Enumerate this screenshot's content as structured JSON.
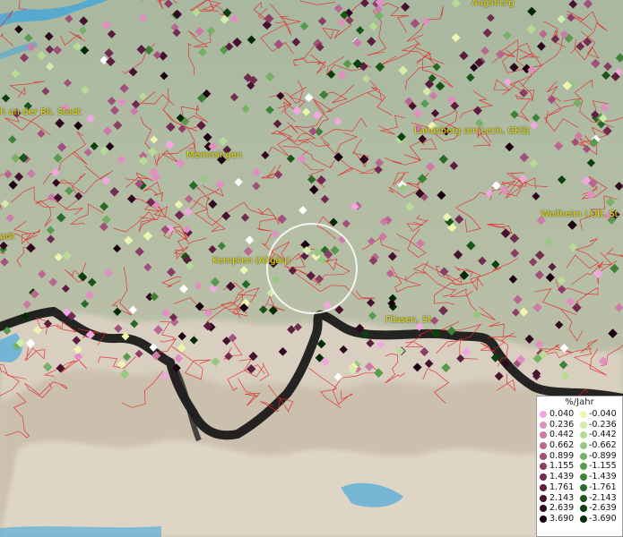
{
  "cities": [
    {
      "name": "Augsburg"
    },
    {
      "name": "h an der Ril, Stadt"
    },
    {
      "name": "Memmingen"
    },
    {
      "name": "Landsberg am Lech, GKSt"
    },
    {
      "name": "Weilheim i.OB, St"
    },
    {
      "name": "adt"
    },
    {
      "name": "Kempten (Allgäu)"
    },
    {
      "name": "Füssen, St"
    }
  ],
  "legend": {
    "title": "%/Jahr",
    "positive": [
      {
        "value": "0.040",
        "color": "#f0a8e0"
      },
      {
        "value": "0.236",
        "color": "#e090c0"
      },
      {
        "value": "0.442",
        "color": "#cc7aa6"
      },
      {
        "value": "0.662",
        "color": "#b86890"
      },
      {
        "value": "0.899",
        "color": "#a0507a"
      },
      {
        "value": "1.155",
        "color": "#8a3e66"
      },
      {
        "value": "1.439",
        "color": "#722c52"
      },
      {
        "value": "1.761",
        "color": "#5c1e40"
      },
      {
        "value": "2.143",
        "color": "#461230"
      },
      {
        "value": "2.639",
        "color": "#300820"
      },
      {
        "value": "3.690",
        "color": "#1a0010"
      }
    ],
    "negative": [
      {
        "value": "-0.040",
        "color": "#eef5b0"
      },
      {
        "value": "-0.236",
        "color": "#d4ecaa"
      },
      {
        "value": "-0.442",
        "color": "#b8dc98"
      },
      {
        "value": "-0.662",
        "color": "#98c880"
      },
      {
        "value": "-0.899",
        "color": "#78b068"
      },
      {
        "value": "-1.155",
        "color": "#5a9a4e"
      },
      {
        "value": "-1.439",
        "color": "#3e8238"
      },
      {
        "value": "-1.761",
        "color": "#2a6a28"
      },
      {
        "value": "-2.143",
        "color": "#1a5418"
      },
      {
        "value": "-2.639",
        "color": "#0c400c"
      },
      {
        "value": "-3.690",
        "color": "#032a04"
      }
    ]
  }
}
